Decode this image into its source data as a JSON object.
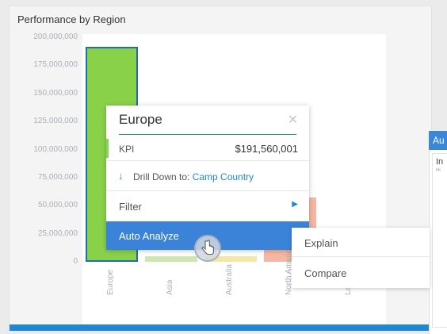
{
  "panel": {
    "title": "Performance by Region"
  },
  "chart_data": {
    "type": "bar",
    "title": "Performance by Region",
    "categories": [
      "Europe",
      "Asia",
      "Australia",
      "North America",
      "Latin Am"
    ],
    "values": [
      191560001,
      5000000,
      5000000,
      57000000,
      null
    ],
    "ylim": [
      0,
      200000000
    ],
    "yticks": [
      "0",
      "25,000,000",
      "50,000,000",
      "75,000,000",
      "100,000,000",
      "125,000,000",
      "150,000,000",
      "175,000,000",
      "200,000,000"
    ],
    "bar_colors": [
      "#8ad14a",
      "#cde7b0",
      "#f6e6a6",
      "#f7b6a1",
      "#ffffff"
    ],
    "selected_bar_outline": "#1e6fae"
  },
  "popup": {
    "title": "Europe",
    "close_icon": "close-icon",
    "kpi_label": "KPI",
    "kpi_value": "$191,560,001",
    "drill_prefix": "Drill Down to:",
    "drill_target": "Camp Country",
    "filter_label": "Filter",
    "auto_analyze_label": "Auto Analyze"
  },
  "submenu": {
    "items": [
      {
        "label": "Explain"
      },
      {
        "label": "Compare"
      }
    ]
  },
  "right_panel": {
    "header": "Au",
    "card_title": "In",
    "card_sub": "Hi"
  },
  "colors": {
    "accent": "#3b83d9",
    "link": "#1e88d6"
  }
}
